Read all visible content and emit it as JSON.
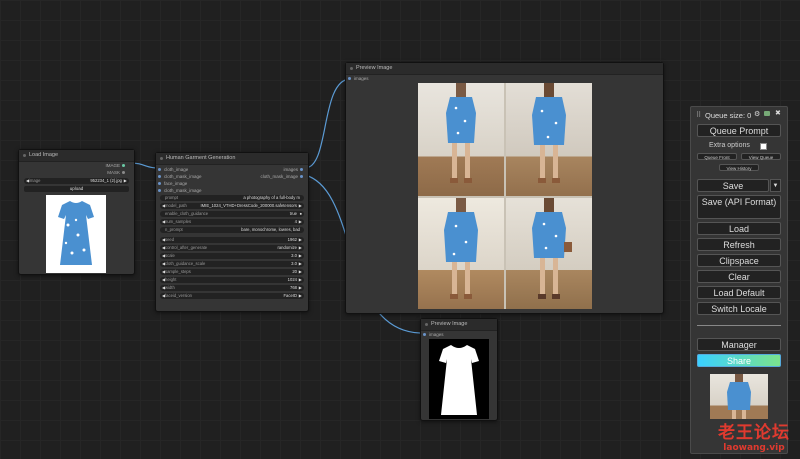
{
  "load_image": {
    "title": "Load Image",
    "out_image": "IMAGE",
    "out_mask": "MASK",
    "image_label": "image",
    "image_value": "952234_1 (2).jpg",
    "upload_label": "upload"
  },
  "garment": {
    "title": "Human Garment Generation",
    "inputs": [
      "cloth_image",
      "cloth_mask_image",
      "face_image",
      "cloth_mask_image"
    ],
    "outputs": [
      "images",
      "cloth_mask_image"
    ],
    "widgets": [
      {
        "label": "prompt",
        "value": "a photography of a full-body m"
      },
      {
        "label": "model_path",
        "value": "IMIE_1024_VTHD+DressCode_200000.safetensors"
      },
      {
        "label": "enable_cloth_guidance",
        "value": "true"
      },
      {
        "label": "num_samples",
        "value": "4"
      },
      {
        "label": "n_prompt",
        "value": "bare, monochrome, lowres, bad"
      },
      {
        "label": "seed",
        "value": "1962"
      },
      {
        "label": "control_after_generate",
        "value": "randomize"
      },
      {
        "label": "scale",
        "value": "3.0"
      },
      {
        "label": "cloth_guidance_scale",
        "value": "3.0"
      },
      {
        "label": "sample_steps",
        "value": "20"
      },
      {
        "label": "height",
        "value": "1024"
      },
      {
        "label": "width",
        "value": "768"
      },
      {
        "label": "faceid_version",
        "value": "FaceID"
      }
    ]
  },
  "preview1": {
    "title": "Preview Image",
    "input": "images"
  },
  "preview2": {
    "title": "Preview Image",
    "input": "images"
  },
  "menu": {
    "queue_size": "Queue size: 0",
    "queue_prompt": "Queue Prompt",
    "extra_options": "Extra options",
    "queue_front": "Queue Front",
    "view_queue": "View Queue",
    "view_history": "View History",
    "save": "Save",
    "save_api": "Save (API Format)",
    "load": "Load",
    "refresh": "Refresh",
    "clipspace": "Clipspace",
    "clear": "Clear",
    "load_default": "Load Default",
    "switch_locale": "Switch Locale",
    "manager": "Manager",
    "share": "Share"
  },
  "watermark": {
    "line1": "老王论坛",
    "line2": "laowang.vip"
  },
  "colors": {
    "link": "#5b9bd5",
    "dress": "#4a90d0",
    "share_gradient_start": "#3ad0ff",
    "share_gradient_end": "#7be38c"
  }
}
